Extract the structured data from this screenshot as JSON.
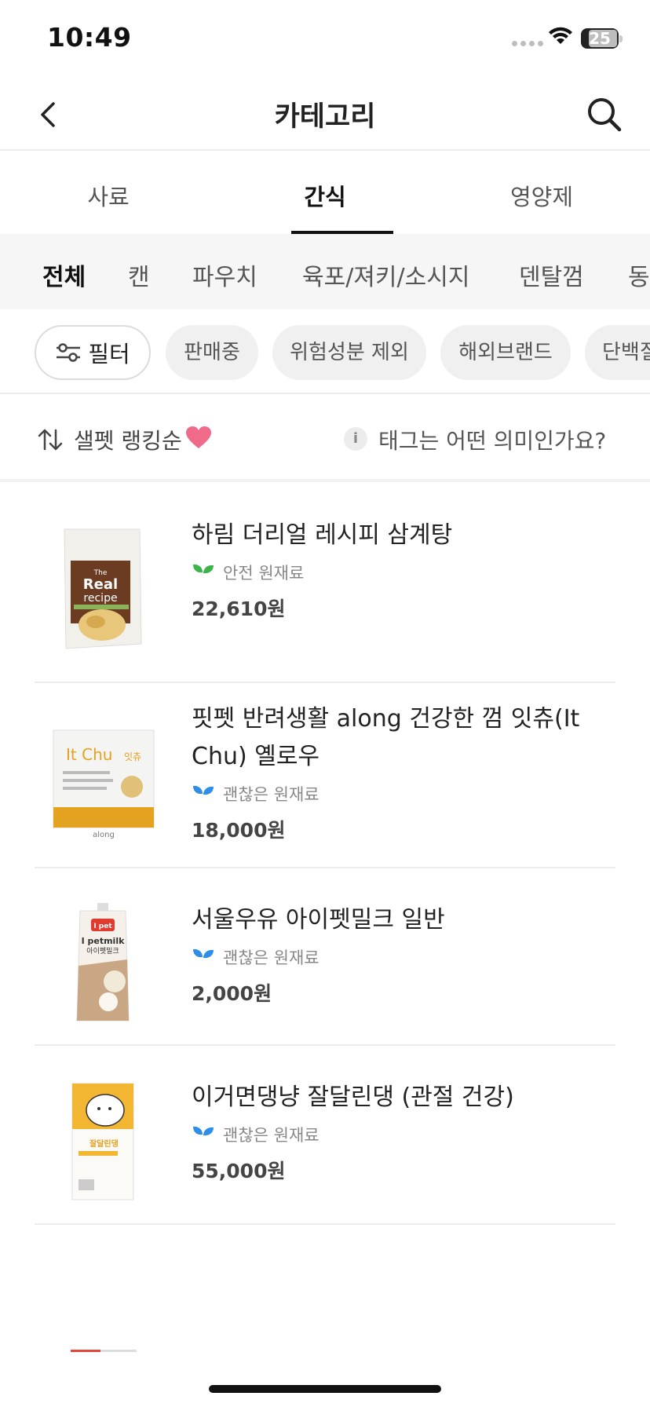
{
  "status": {
    "time": "10:49",
    "battery": "25"
  },
  "header": {
    "title": "카테고리"
  },
  "tabs": [
    {
      "label": "사료",
      "active": false
    },
    {
      "label": "간식",
      "active": true
    },
    {
      "label": "영양제",
      "active": false
    }
  ],
  "subcategories": [
    {
      "label": "전체",
      "active": true
    },
    {
      "label": "캔",
      "active": false
    },
    {
      "label": "파우치",
      "active": false
    },
    {
      "label": "육포/져키/소시지",
      "active": false
    },
    {
      "label": "덴탈껌",
      "active": false
    },
    {
      "label": "동",
      "active": false
    }
  ],
  "filter": {
    "label": "필터"
  },
  "chips": [
    "판매중",
    "위험성분 제외",
    "해외브랜드",
    "단백질"
  ],
  "sort": {
    "label": "샐펫 랭킹순",
    "tag_help": "태그는 어떤 의미인가요?",
    "info_glyph": "i"
  },
  "products": [
    {
      "name": "하림 더리얼 레시피 삼계탕",
      "tag": "안전 원재료",
      "tag_color": "#3cb44a",
      "price": "22,610원"
    },
    {
      "name": "핏펫 반려생활 along 건강한 껌 잇츄(It Chu) 옐로우",
      "tag": "괜찮은 원재료",
      "tag_color": "#2f8fe8",
      "price": "18,000원"
    },
    {
      "name": "서울우유 아이펫밀크 일반",
      "tag": "괜찮은 원재료",
      "tag_color": "#2f8fe8",
      "price": "2,000원"
    },
    {
      "name": "이거면댕냥 잘달린댕 (관절 건강)",
      "tag": "괜찮은 원재료",
      "tag_color": "#2f8fe8",
      "price": "55,000원"
    }
  ],
  "product_images": {
    "p1": {
      "brand": "The",
      "line1": "Real",
      "line2": "recipe"
    },
    "p2": {
      "brand": "It Chu",
      "brand_kr": "잇츄",
      "maker": "along"
    },
    "p3": {
      "brand": "I pet",
      "line1": "I petmilk",
      "line2": "아이펫밀크"
    },
    "p4": {
      "line1": "잘달린댕"
    }
  },
  "loading": {
    "progress": 0.45
  },
  "colors": {
    "accent_heart": "#f06a8a",
    "safe_green": "#3cb44a",
    "ok_blue": "#2f8fe8"
  }
}
